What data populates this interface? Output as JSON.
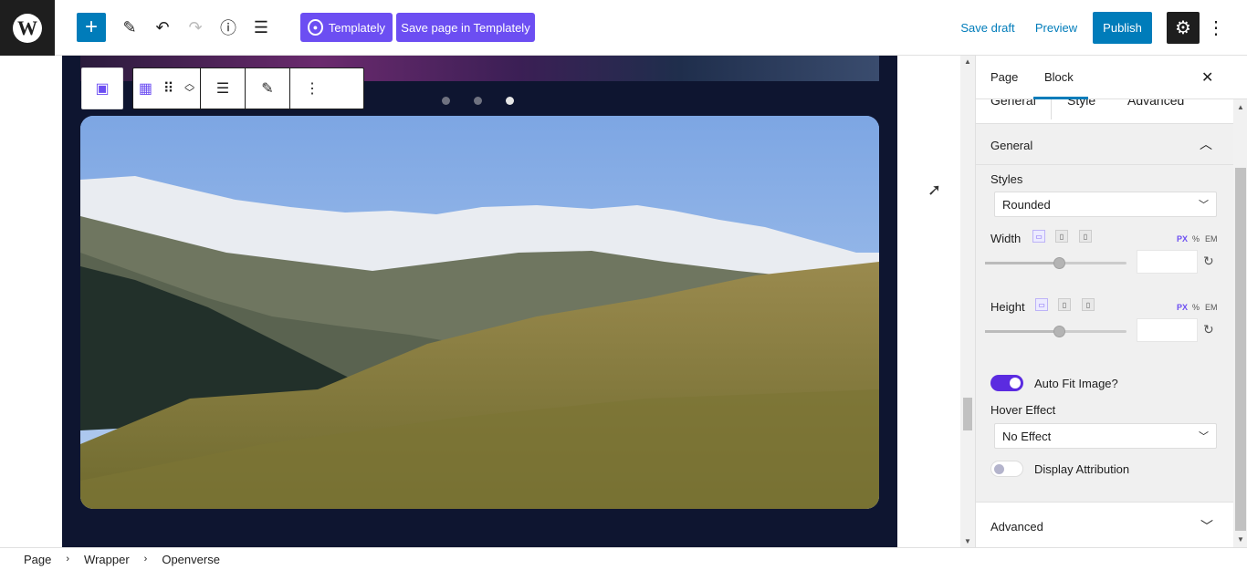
{
  "topbar": {
    "logo_text": "W",
    "add_icon": "plus-icon",
    "templately_label": "Templately",
    "save_templately_label": "Save page in Templately",
    "save_draft_label": "Save draft",
    "preview_label": "Preview",
    "publish_label": "Publish",
    "accent_color": "#6c4ef2",
    "brand_color": "#007cba"
  },
  "canvas": {
    "slider_dots": 3,
    "active_dot": 3
  },
  "sidebar": {
    "tabs": [
      "Page",
      "Block"
    ],
    "active_tab": "Block",
    "sub_tabs": [
      "General",
      "Style",
      "Advanced"
    ],
    "general_panel": {
      "title": "General",
      "styles_label": "Styles",
      "styles_value": "Rounded",
      "width_label": "Width",
      "height_label": "Height",
      "units": [
        "PX",
        "%",
        "EM"
      ],
      "active_unit": "PX",
      "width_value": "",
      "height_value": "",
      "auto_fit_label": "Auto Fit Image?",
      "auto_fit_on": true,
      "hover_effect_label": "Hover Effect",
      "hover_effect_value": "No Effect",
      "display_attribution_label": "Display Attribution",
      "display_attribution_on": false
    },
    "advanced_title": "Advanced"
  },
  "footer": {
    "breadcrumbs": [
      "Page",
      "Wrapper",
      "Openverse"
    ]
  }
}
